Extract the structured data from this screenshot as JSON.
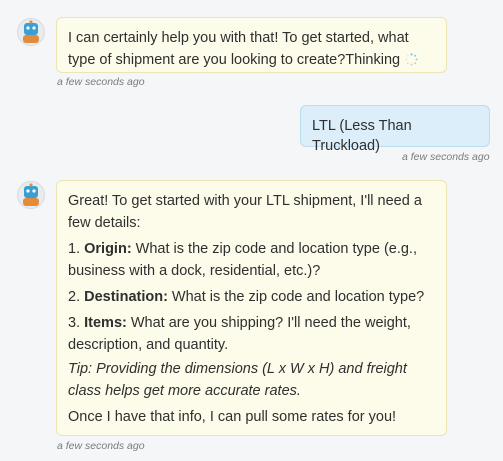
{
  "messages": [
    {
      "sender": "bot",
      "text": "I can certainly help you with that! To get started, what type of shipment are you looking to create?",
      "status_text": "Thinking",
      "time": "a few seconds ago"
    },
    {
      "sender": "user",
      "text": "LTL (Less Than Truckload)",
      "time": "a few seconds ago"
    },
    {
      "sender": "bot",
      "intro": "Great! To get started with your LTL shipment, I'll need a few details:",
      "items": [
        {
          "number": "1.",
          "label": "Origin:",
          "text": " What is the zip code and location type (e.g., business with a dock, residential, etc.)?"
        },
        {
          "number": "2.",
          "label": "Destination:",
          "text": " What is the zip code and location type?"
        },
        {
          "number": "3.",
          "label": "Items:",
          "text": " What are you shipping? I'll need the weight, description, and quantity."
        }
      ],
      "tip": "Tip: Providing the dimensions (L x W x H) and freight class helps get more accurate rates.",
      "closing": "Once I have that info, I can pull some rates for you!",
      "time": "a few seconds ago"
    }
  ],
  "icons": {
    "bot_avatar": "bot-avatar-icon",
    "spinner": "loading-spinner-icon"
  },
  "colors": {
    "bot_bubble": "#fdfbea",
    "user_bubble": "#dbeef9",
    "page_background": "#f4f6f8"
  }
}
